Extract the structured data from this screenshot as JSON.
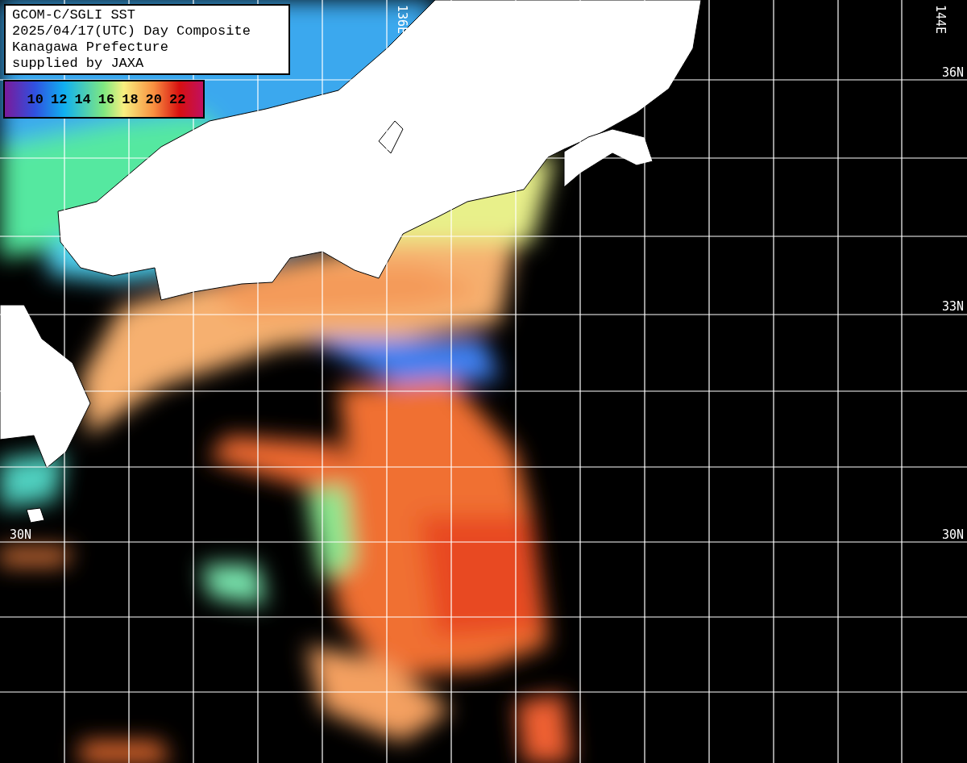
{
  "title_box": {
    "lines": [
      "GCOM-C/SGLI SST",
      "2025/04/17(UTC) Day Composite",
      "Kanagawa Prefecture",
      "supplied by JAXA"
    ]
  },
  "legend": {
    "labels": [
      "10",
      "12",
      "14",
      "16",
      "18",
      "20",
      "22"
    ]
  },
  "longitude_labels": [
    {
      "text": "136E"
    },
    {
      "text": "144E"
    }
  ],
  "latitude_labels": [
    {
      "text": "36N"
    },
    {
      "text": "33N"
    },
    {
      "text": "30N"
    },
    {
      "text": "30N"
    }
  ]
}
